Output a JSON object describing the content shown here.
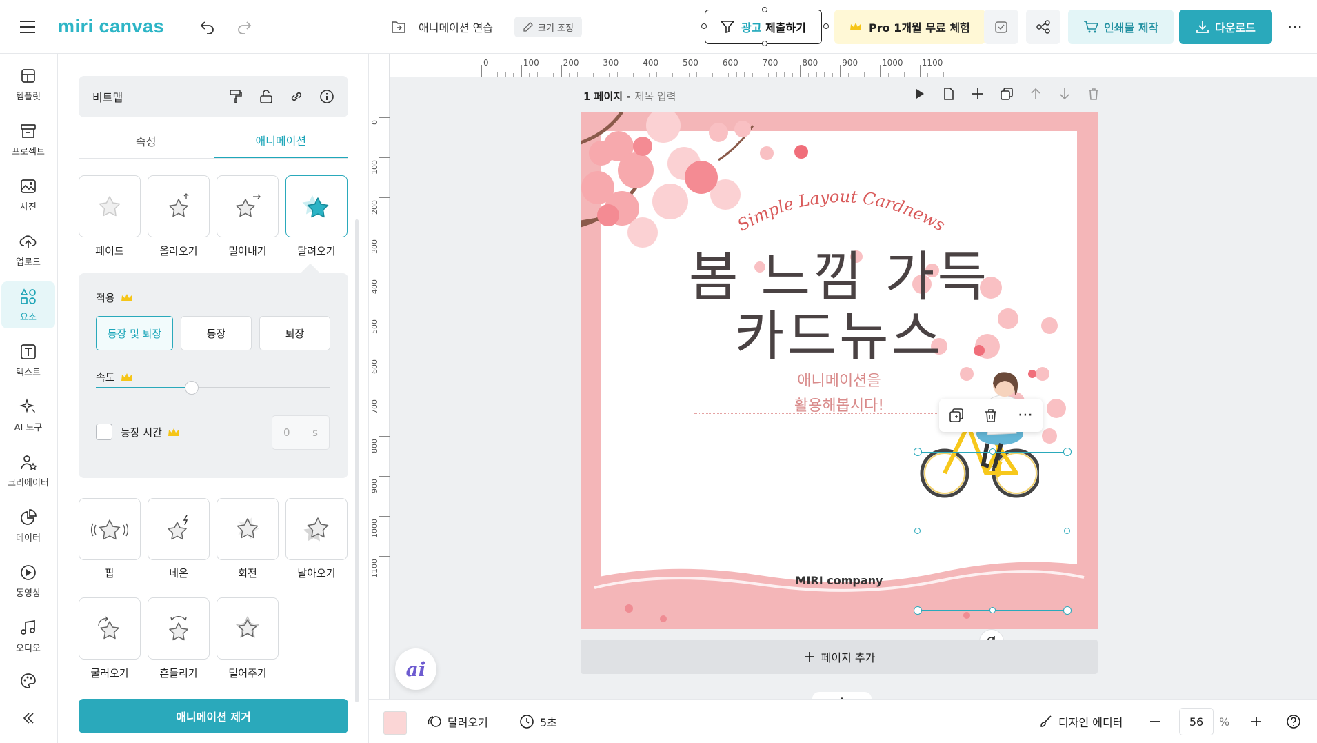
{
  "topbar": {
    "logo": "miri canvas",
    "doc_name": "애니메이션 연습",
    "resize_label": "크기 조정",
    "ad_submit": "광고 제출하기",
    "pro_trial": "Pro 1개월 무료 체험",
    "print_label": "인쇄물 제작",
    "download_label": "다운로드"
  },
  "rail": {
    "items": [
      {
        "label": "템플릿",
        "icon": "template-icon"
      },
      {
        "label": "프로젝트",
        "icon": "project-icon"
      },
      {
        "label": "사진",
        "icon": "photo-icon"
      },
      {
        "label": "업로드",
        "icon": "upload-icon"
      },
      {
        "label": "요소",
        "icon": "elements-icon"
      },
      {
        "label": "텍스트",
        "icon": "text-icon"
      },
      {
        "label": "AI 도구",
        "icon": "ai-tools-icon"
      },
      {
        "label": "크리에이터",
        "icon": "creator-icon"
      },
      {
        "label": "데이터",
        "icon": "data-icon"
      },
      {
        "label": "동영상",
        "icon": "video-icon"
      },
      {
        "label": "오디오",
        "icon": "audio-icon"
      }
    ],
    "active_index": 4
  },
  "panel": {
    "element_type": "비트맵",
    "tabs": [
      "속성",
      "애니메이션"
    ],
    "active_tab": 1,
    "animations_top": [
      "페이드",
      "올라오기",
      "밀어내기",
      "달려오기"
    ],
    "selected_animation": "달려오기",
    "apply_title": "적용",
    "apply_options": [
      "등장 및 퇴장",
      "등장",
      "퇴장"
    ],
    "apply_selected": 0,
    "speed_title": "속도",
    "speed_value": 0.41,
    "appear_time_label": "등장 시간",
    "appear_time_value": "0",
    "appear_time_unit": "s",
    "animations_more": [
      "팝",
      "네온",
      "회전",
      "날아오기",
      "굴러오기",
      "흔들리기",
      "털어주기"
    ],
    "remove_label": "애니메이션 제거"
  },
  "ruler": {
    "h_ticks": [
      "0",
      "100",
      "200",
      "300",
      "400",
      "500",
      "600",
      "700",
      "800",
      "900",
      "1000",
      "1100"
    ],
    "v_ticks": [
      "0",
      "100",
      "200",
      "300",
      "400",
      "500",
      "600",
      "700",
      "800",
      "900",
      "1000",
      "1100"
    ]
  },
  "page": {
    "number": "1 페이지 -",
    "title_placeholder": "제목 입력",
    "add_page": "페이지 추가"
  },
  "card": {
    "subtitle": "Simple Layout Cardnews",
    "title_line1": "봄 느낌 가득",
    "title_line2": "카드뉴스",
    "body_line1": "애니메이션을",
    "body_line2": "활용해봅시다!",
    "company": "MIRI company"
  },
  "bottombar": {
    "animation_name": "달려오기",
    "duration": "5초",
    "design_editor": "디자인 에디터",
    "zoom_value": "56",
    "zoom_unit": "%"
  },
  "colors": {
    "accent": "#2aa9bb",
    "card_bg": "#f4b6b8",
    "pro_bg": "#fff8d6"
  }
}
